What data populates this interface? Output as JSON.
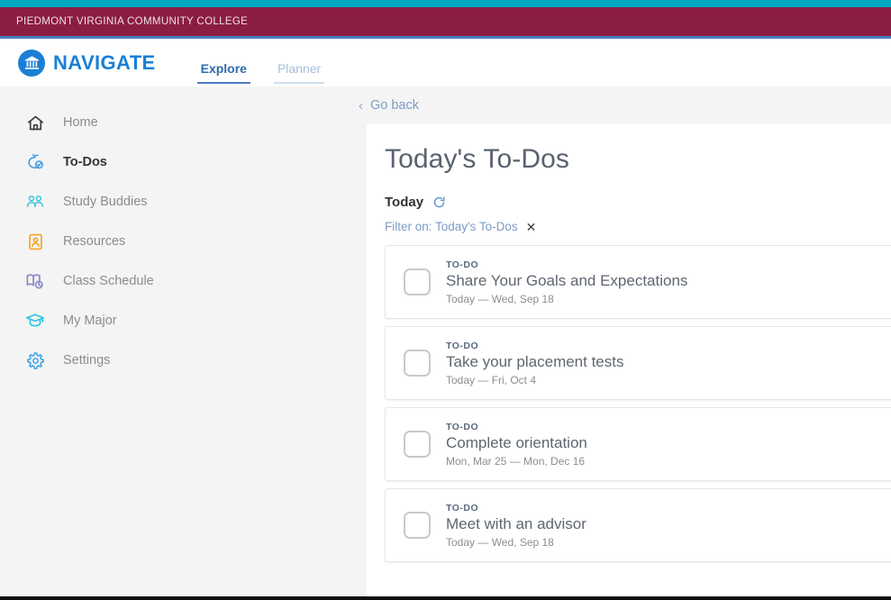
{
  "institution": {
    "name": "PIEDMONT VIRGINIA COMMUNITY COLLEGE"
  },
  "brand": {
    "name": "NAVIGATE",
    "icon": "university-building-icon"
  },
  "tabs": [
    {
      "label": "Explore",
      "active": true
    },
    {
      "label": "Planner",
      "active": false
    }
  ],
  "sidebar": {
    "items": [
      {
        "label": "Home",
        "icon": "home-icon",
        "active": false
      },
      {
        "label": "To-Dos",
        "icon": "todo-check-icon",
        "active": true
      },
      {
        "label": "Study Buddies",
        "icon": "people-icon",
        "active": false
      },
      {
        "label": "Resources",
        "icon": "id-card-icon",
        "active": false
      },
      {
        "label": "Class Schedule",
        "icon": "book-clock-icon",
        "active": false
      },
      {
        "label": "My Major",
        "icon": "graduation-cap-icon",
        "active": false
      },
      {
        "label": "Settings",
        "icon": "gear-icon",
        "active": false
      }
    ]
  },
  "main": {
    "go_back": "Go back",
    "go_back_icon": "chevron-left-icon",
    "page_title": "Today's To-Dos",
    "section_label": "Today",
    "refresh_icon": "refresh-icon",
    "filter_text": "Filter on: Today's To-Dos",
    "filter_clear_icon": "close-x-icon",
    "todos": [
      {
        "kicker": "TO-DO",
        "title": "Share Your Goals and Expectations",
        "dates": "Today — Wed, Sep 18",
        "checked": false
      },
      {
        "kicker": "TO-DO",
        "title": "Take your placement tests",
        "dates": "Today — Fri, Oct 4",
        "checked": false
      },
      {
        "kicker": "TO-DO",
        "title": "Complete orientation",
        "dates": "Mon, Mar 25 — Mon, Dec 16",
        "checked": false
      },
      {
        "kicker": "TO-DO",
        "title": "Meet with an advisor",
        "dates": "Today — Wed, Sep 18",
        "checked": false
      }
    ]
  },
  "colors": {
    "teal_strip": "#01a9c1",
    "institution_band": "#8b1d41",
    "blue_rule": "#4a7fc1",
    "brand_blue": "#1a7fd4",
    "link_blue": "#7d9cc4",
    "active_tab": "#2e6bb0",
    "icon_teal": "#3ec6dd",
    "icon_orange": "#f5a623",
    "icon_purple": "#8b87c9",
    "icon_cyan": "#28c4e0",
    "icon_blue": "#3fa5e8",
    "title_gray": "#5a6270"
  }
}
